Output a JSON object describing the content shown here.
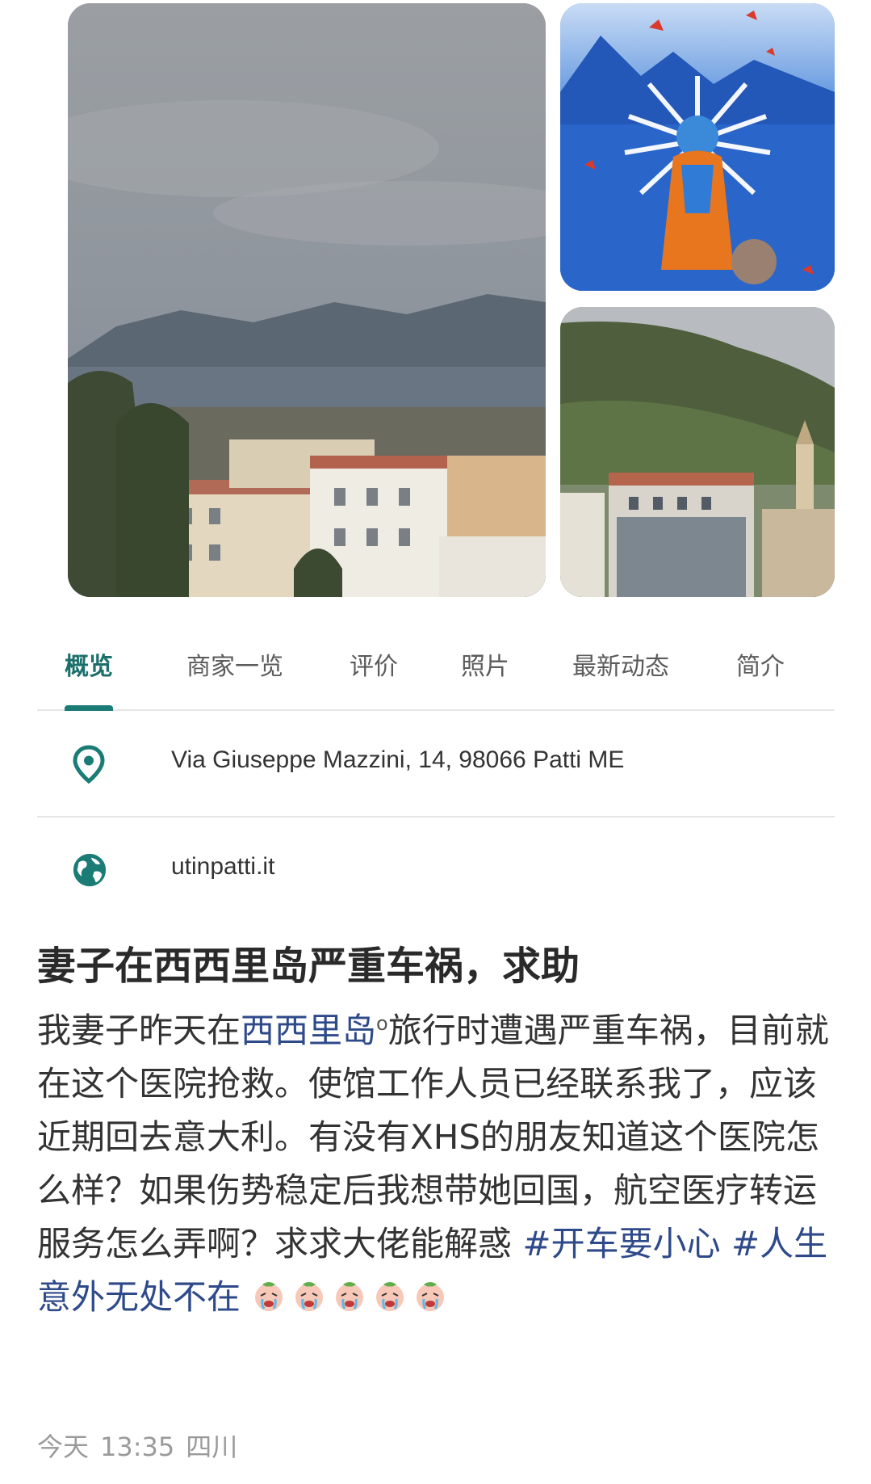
{
  "tabs": [
    {
      "label": "概览",
      "active": true
    },
    {
      "label": "商家一览",
      "active": false
    },
    {
      "label": "评价",
      "active": false
    },
    {
      "label": "照片",
      "active": false
    },
    {
      "label": "最新动态",
      "active": false
    },
    {
      "label": "简介",
      "active": false
    }
  ],
  "place": {
    "address": "Via Giuseppe Mazzini, 14, 98066 Patti ME",
    "address_icon": "location-pin-icon",
    "website": "utinpatti.it",
    "website_icon": "globe-icon",
    "accent_color": "#1b7c76"
  },
  "post": {
    "title": "妻子在西西里岛严重车祸，求助",
    "body_prefix": "我妻子昨天在",
    "keyword": "西西里岛",
    "body_main": "旅行时遭遇严重车祸，目前就在这个医院抢救。使馆工作人员已经联系我了，应该近期回去意大利。有没有XHS的朋友知道这个医院怎么样？如果伤势稳定后我想带她回国，航空医疗转运服务怎么弄啊？求求大佬能解惑",
    "tags": [
      "#开车要小心",
      "#人生意外无处不在"
    ],
    "emoji_name": "crying-face-emoji",
    "emoji_count": 5
  },
  "meta": {
    "date": "今天",
    "time": "13:35",
    "location": "四川"
  }
}
